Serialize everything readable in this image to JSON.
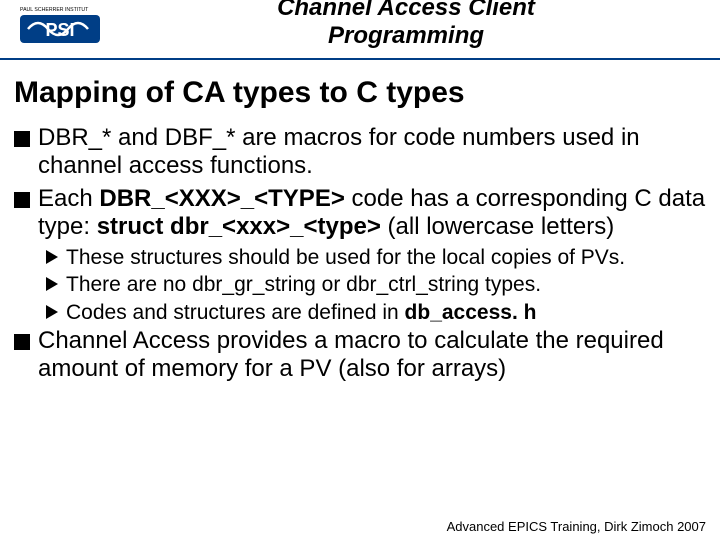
{
  "header": {
    "logo_top_text": "PAUL SCHERRER INSTITUT",
    "title_line1": "Channel Access Client",
    "title_line2": "Programming"
  },
  "slide_title": "Mapping of CA types to C types",
  "bullets": {
    "b1_pre": "DBR_* and DBF_* are macros for code numbers used in channel access functions.",
    "b2_p1": "Each ",
    "b2_b1": "DBR_<XXX>_<TYPE>",
    "b2_p2": " code has a corresponding C data type: ",
    "b2_b2": "struct dbr_<xxx>_<type>",
    "b2_p3": " (all lowercase letters)",
    "s1": "These structures should be used for the local copies of PVs.",
    "s2": "There are no dbr_gr_string or dbr_ctrl_string types.",
    "s3_p1": "Codes and structures are defined in ",
    "s3_b1": "db_access. h",
    "b3": "Channel Access provides a macro to calculate the required amount of memory for a PV (also for arrays)"
  },
  "footer": "Advanced EPICS Training, Dirk Zimoch 2007"
}
